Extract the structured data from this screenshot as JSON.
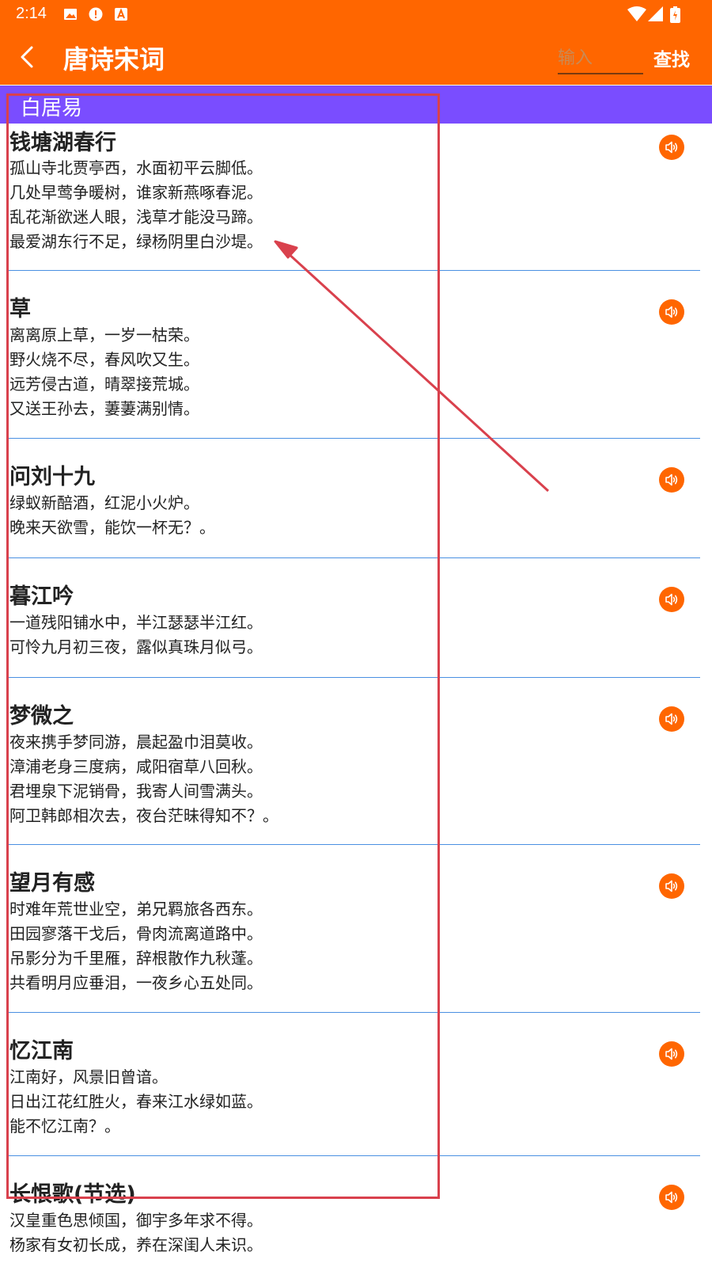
{
  "status_bar": {
    "time": "2:14"
  },
  "header": {
    "title": "唐诗宋词",
    "search_placeholder": "输入",
    "search_button": "查找"
  },
  "author": "白居易",
  "poems": [
    {
      "title": "钱塘湖春行",
      "lines": [
        "孤山寺北贾亭西，水面初平云脚低。",
        "几处早莺争暖树，谁家新燕啄春泥。",
        "乱花渐欲迷人眼，浅草才能没马蹄。",
        "最爱湖东行不足，绿杨阴里白沙堤。"
      ]
    },
    {
      "title": "草",
      "lines": [
        "离离原上草，一岁一枯荣。",
        "野火烧不尽，春风吹又生。",
        "远芳侵古道，晴翠接荒城。",
        "又送王孙去，萋萋满别情。"
      ]
    },
    {
      "title": "问刘十九",
      "lines": [
        "绿蚁新醅酒，红泥小火炉。",
        "晚来天欲雪，能饮一杯无？。"
      ]
    },
    {
      "title": "暮江吟",
      "lines": [
        "一道残阳铺水中，半江瑟瑟半江红。",
        "可怜九月初三夜，露似真珠月似弓。"
      ]
    },
    {
      "title": "梦微之",
      "lines": [
        "夜来携手梦同游，晨起盈巾泪莫收。",
        "漳浦老身三度病，咸阳宿草八回秋。",
        "君埋泉下泥销骨，我寄人间雪满头。",
        "阿卫韩郎相次去，夜台茫昧得知不？。"
      ]
    },
    {
      "title": "望月有感",
      "lines": [
        "时难年荒世业空，弟兄羁旅各西东。",
        "田园寥落干戈后，骨肉流离道路中。",
        "吊影分为千里雁，辞根散作九秋蓬。",
        "共看明月应垂泪，一夜乡心五处同。"
      ]
    },
    {
      "title": "忆江南",
      "lines": [
        "江南好，风景旧曾谙。",
        "日出江花红胜火，春来江水绿如蓝。",
        "能不忆江南？。"
      ]
    },
    {
      "title": "长恨歌(节选)",
      "lines": [
        "汉皇重色思倾国，御宇多年求不得。",
        "杨家有女初长成，养在深闺人未识。"
      ]
    }
  ]
}
